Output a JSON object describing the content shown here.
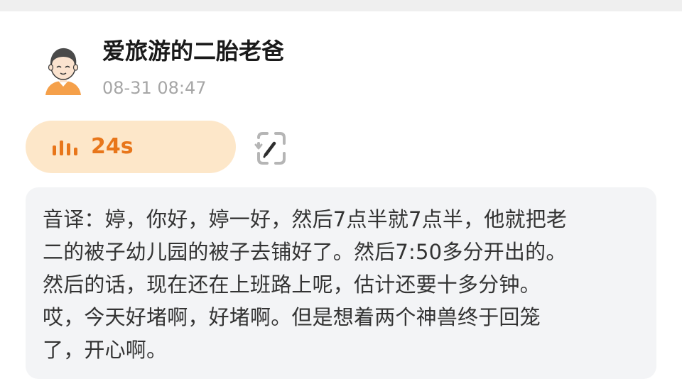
{
  "post": {
    "author": "爱旅游的二胎老爸",
    "time": "08-31 08:47",
    "avatar_icon": "cartoon-avatar-icon"
  },
  "voice": {
    "duration": "24s",
    "icon": "sound-bars-icon",
    "accent_color": "#e8761a",
    "bubble_color": "#fde7c9"
  },
  "edit": {
    "icon": "edit-pencil-icon"
  },
  "transcript": {
    "lines": [
      "音译：婷，你好，婷一好，然后7点半就7点半，他就把老",
      "二的被子幼儿园的被子去铺好了。然后7:50多分开出的。",
      "然后的话，现在还在上班路上呢，估计还要十多分钟。",
      "哎，今天好堵啊，好堵啊。但是想着两个神兽终于回笼",
      "了，开心啊。"
    ]
  }
}
